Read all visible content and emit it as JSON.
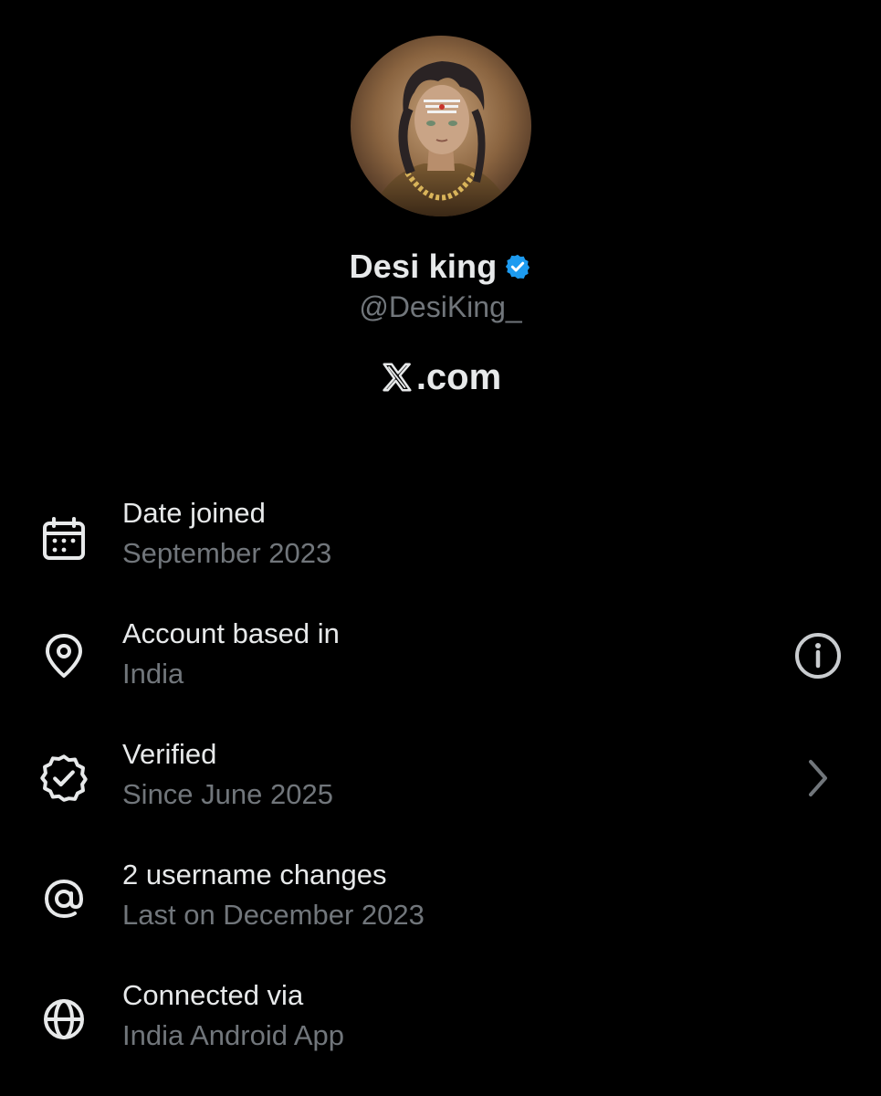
{
  "profile": {
    "display_name": "Desi king",
    "handle": "@DesiKing_",
    "site": ".com",
    "verified_color": "#1d9bf0"
  },
  "info_items": [
    {
      "title": "Date joined",
      "subtitle": "September 2023",
      "icon": "calendar-icon"
    },
    {
      "title": "Account based in",
      "subtitle": "India",
      "icon": "location-pin-icon",
      "trailing": "info-icon"
    },
    {
      "title": "Verified",
      "subtitle": "Since June 2025",
      "icon": "verified-badge-icon",
      "trailing": "chevron-right-icon"
    },
    {
      "title": "2 username changes",
      "subtitle": "Last on December 2023",
      "icon": "at-sign-icon"
    },
    {
      "title": "Connected via",
      "subtitle": "India Android App",
      "icon": "globe-icon"
    }
  ],
  "colors": {
    "background": "#000000",
    "primary_text": "#e7e9ea",
    "secondary_text": "#71767b"
  }
}
